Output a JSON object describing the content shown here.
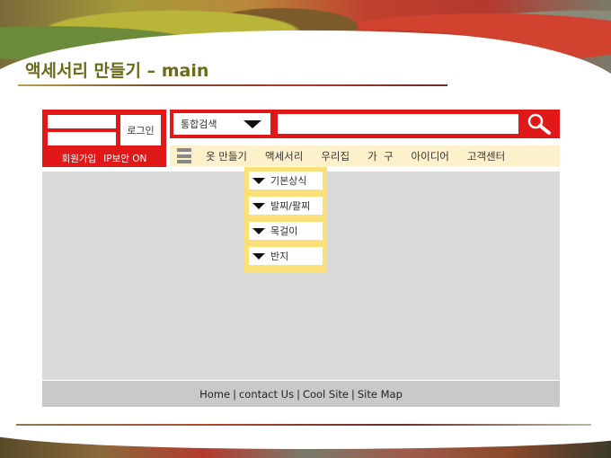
{
  "page": {
    "title": "액세서리 만들기 – main"
  },
  "login": {
    "button_label": "로그인",
    "signup_label": "회원가입",
    "ip_security_label": "IP보안 ON"
  },
  "search": {
    "scope_label": "통합검색",
    "placeholder": ""
  },
  "nav": {
    "items": [
      {
        "label": "옷 만들기"
      },
      {
        "label": "액세서리"
      },
      {
        "label": "우리집"
      },
      {
        "label": "가  구"
      },
      {
        "label": "아이디어"
      },
      {
        "label": "고객센터"
      }
    ]
  },
  "dropdown": {
    "items": [
      {
        "label": "기본상식"
      },
      {
        "label": "발찌/팔찌"
      },
      {
        "label": "목걸이"
      },
      {
        "label": "반지"
      }
    ]
  },
  "footer": {
    "links": [
      {
        "label": "Home"
      },
      {
        "label": "contact Us"
      },
      {
        "label": "Cool Site"
      },
      {
        "label": "Site Map"
      }
    ],
    "separator": "|"
  },
  "colors": {
    "accent_red": "#e01818",
    "nav_bg": "#fdf1cc",
    "dropdown_bg": "#fbe07a",
    "content_bg": "#d9d9d9",
    "footer_bg": "#c9c9c9",
    "title_color": "#6b6a1a"
  },
  "icons": {
    "search": "search-icon",
    "menu": "menu-icon",
    "chevron": "chevron-down-icon"
  }
}
